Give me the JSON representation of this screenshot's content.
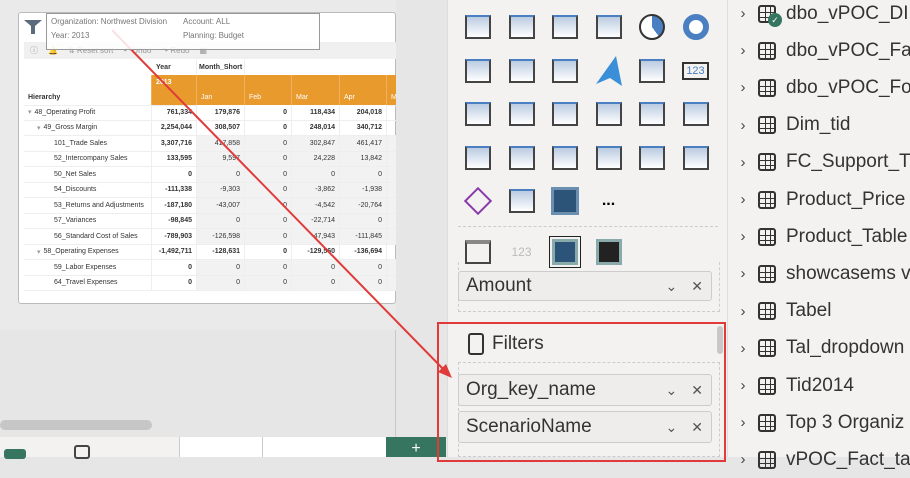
{
  "visual": {
    "info": {
      "organization": "Organization: Northwest Division",
      "account": "Account: ALL",
      "year": "Year: 2013",
      "planning": "Planning: Budget"
    },
    "toolbar": {
      "reset_sort": "Reset sort",
      "undo": "Undo",
      "redo": "Redo"
    },
    "headers": {
      "year": "Year",
      "month": "Month_Short",
      "year_value": "2013",
      "hierarchy": "Hierarchy",
      "months": [
        "Jan",
        "Feb",
        "Mar",
        "Apr",
        "M"
      ]
    },
    "rows": [
      {
        "label": "48_Operating Profit",
        "expand": true,
        "level": 0,
        "values": [
          "761,334",
          "179,876",
          "0",
          "118,434",
          "204,018"
        ]
      },
      {
        "label": "49_Gross Margin",
        "expand": true,
        "level": 1,
        "values": [
          "2,254,044",
          "308,507",
          "0",
          "248,014",
          "340,712"
        ]
      },
      {
        "label": "101_Trade Sales",
        "level": 2,
        "values": [
          "3,307,716",
          "417,858",
          "0",
          "302,847",
          "461,417"
        ]
      },
      {
        "label": "52_Intercompany Sales",
        "level": 2,
        "values": [
          "133,595",
          "9,597",
          "0",
          "24,228",
          "13,842"
        ]
      },
      {
        "label": "50_Net Sales",
        "level": 2,
        "values": [
          "0",
          "0",
          "0",
          "0",
          "0"
        ]
      },
      {
        "label": "54_Discounts",
        "level": 2,
        "values": [
          "-111,338",
          "-9,303",
          "0",
          "-3,862",
          "-1,938"
        ]
      },
      {
        "label": "53_Returns and Adjustments",
        "level": 2,
        "values": [
          "-187,180",
          "-43,007",
          "0",
          "-4,542",
          "-20,764"
        ]
      },
      {
        "label": "57_Variances",
        "level": 2,
        "values": [
          "-98,845",
          "0",
          "0",
          "-22,714",
          "0"
        ]
      },
      {
        "label": "56_Standard Cost of Sales",
        "level": 2,
        "values": [
          "-789,903",
          "-126,598",
          "0",
          "-47,943",
          "-111,845"
        ]
      },
      {
        "label": "58_Operating Expenses",
        "expand": true,
        "level": 1,
        "values": [
          "-1,492,711",
          "-128,631",
          "0",
          "-129,560",
          "-136,694"
        ]
      },
      {
        "label": "59_Labor Expenses",
        "level": 2,
        "values": [
          "0",
          "0",
          "0",
          "0",
          "0"
        ]
      },
      {
        "label": "64_Travel Expenses",
        "level": 2,
        "values": [
          "0",
          "0",
          "0",
          "0",
          "0"
        ]
      }
    ]
  },
  "viz_icons": [
    "ribbon-chart-icon",
    "waterfall-chart-icon",
    "funnel-chart-icon",
    "scatter-chart-icon",
    "pie-chart-icon",
    "donut-chart-icon",
    "treemap-icon",
    "map-globe-icon",
    "filled-map-icon",
    "azure-map-icon",
    "gauge-icon",
    "card-icon",
    "multi-row-card-icon",
    "kpi-icon",
    "slicer-icon",
    "table-icon",
    "matrix-icon",
    "key-influencers-icon",
    "decomposition-tree-icon",
    "qa-icon",
    "smart-narrative-icon",
    "metrics-icon",
    "paginated-report-icon",
    "arcgis-map-icon",
    "power-apps-icon",
    "power-automate-icon",
    "custom-visual-icon",
    "more-visuals-icon"
  ],
  "viz_custom_icons": [
    "custom-slicer-icon",
    "custom-card-icon",
    "custom-visual-selected-icon",
    "custom-visual-dark-icon"
  ],
  "viz_more": "...",
  "card_text": "123",
  "wells": {
    "values_field": "Amount",
    "filters_title": "Filters",
    "filters": [
      "Org_key_name",
      "ScenarioName"
    ]
  },
  "fields": [
    "dbo_vPOC_DI",
    "dbo_vPOC_Fa",
    "dbo_vPOC_Fo",
    "Dim_tid",
    "FC_Support_T",
    "Product_Price",
    "Product_Table",
    "showcasems v",
    "Tabel",
    "Tal_dropdown",
    "Tid2014",
    "Top 3 Organiz",
    "vPOC_Fact_tab"
  ],
  "colors": {
    "accent_orange": "#e89a2c",
    "annotation_red": "#e03a3a",
    "green": "#367560",
    "blue": "#4a7fc1"
  }
}
